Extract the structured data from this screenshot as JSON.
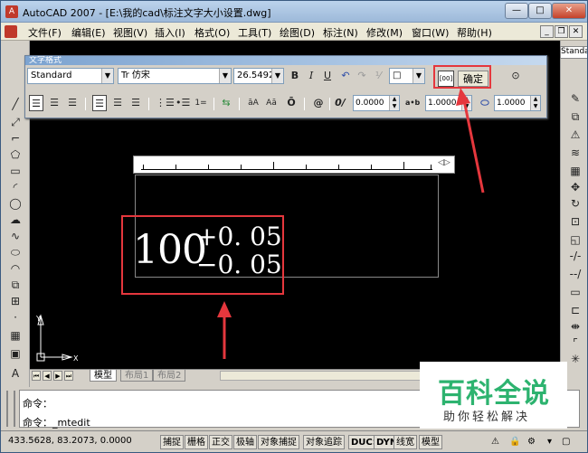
{
  "window": {
    "title": "AutoCAD 2007 - [E:\\我的cad\\标注文字大小设置.dwg]",
    "min_glyph": "—",
    "max_glyph": "□",
    "close_glyph": "✕"
  },
  "menu": {
    "items": [
      "文件(F)",
      "编辑(E)",
      "视图(V)",
      "插入(I)",
      "格式(O)",
      "工具(T)",
      "绘图(D)",
      "标注(N)",
      "修改(M)",
      "窗口(W)",
      "帮助(H)"
    ],
    "mdi": [
      "_",
      "❐",
      "✕"
    ]
  },
  "right_toolbar_label": "Standa",
  "text_format": {
    "title": "文字格式",
    "style_value": "Standard",
    "font_value": "Tr 仿宋",
    "height_value": "26.5492",
    "bold": "B",
    "italic": "I",
    "underline": "U",
    "ok_label": "确定",
    "ruler_label": "[00]",
    "oblique_value": "0.0000",
    "tracking_value": "1.0000",
    "width_value": "1.0000",
    "tracking_icon": "a•b",
    "oblique_icon": "0/",
    "at_icon": "@",
    "overline_icon": "Ō",
    "aa_icon": "āA",
    "Aa_icon": "Aā",
    "number_icon": "1="
  },
  "mtext": {
    "main": "100",
    "upper": "+0. 05",
    "lower": "−0. 05"
  },
  "tabs": {
    "model": "模型",
    "layout1": "布局1",
    "layout2": "布局2"
  },
  "command": {
    "line1": "命令：",
    "line2": "命令：_mtedit"
  },
  "status": {
    "coords": "433.5628, 83.2073, 0.0000",
    "buttons": [
      "捕捉",
      "栅格",
      "正交",
      "极轴",
      "对象捕捉",
      "对象追踪",
      "DUCS",
      "DYN",
      "线宽",
      "模型"
    ]
  },
  "watermark": {
    "logo": "百科全说",
    "sub": "助你轻松解决"
  },
  "colors": {
    "highlight": "#e5373d",
    "canvas": "#000000",
    "watermark_green": "#2db36f"
  }
}
